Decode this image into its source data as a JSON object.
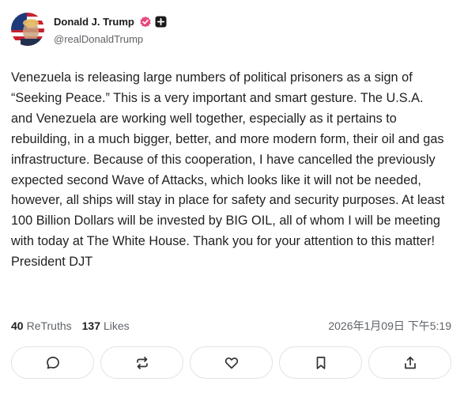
{
  "author": {
    "display_name": "Donald J. Trump",
    "handle": "@realDonaldTrump",
    "avatar_icon": "avatar-flag-portrait",
    "verified_icon": "verified-badge-icon",
    "verified_color": "#e8477a",
    "plus_icon": "plus-square-icon"
  },
  "post": {
    "text": "Venezuela is releasing large numbers of political prisoners as a sign of “Seeking Peace.” This is a very important and smart gesture. The U.S.A. and Venezuela are working well together, especially as it pertains to rebuilding, in a much bigger, better, and more modern form, their oil and gas infrastructure. Because of this cooperation, I have cancelled the previously expected second Wave of Attacks, which looks like it will not be needed, however, all ships will stay in place for safety and security purposes. At least 100 Billion Dollars will be invested by BIG OIL, all of whom I will be meeting with today at The White House. Thank you for your attention to this matter! President DJT"
  },
  "stats": {
    "retruths_count": "40",
    "retruths_label": "ReTruths",
    "likes_count": "137",
    "likes_label": "Likes",
    "timestamp": "2026年1月09日 下午5:19"
  },
  "actions": [
    {
      "icon": "comment-icon"
    },
    {
      "icon": "retruth-icon"
    },
    {
      "icon": "like-heart-icon"
    },
    {
      "icon": "bookmark-icon"
    },
    {
      "icon": "share-icon"
    }
  ]
}
